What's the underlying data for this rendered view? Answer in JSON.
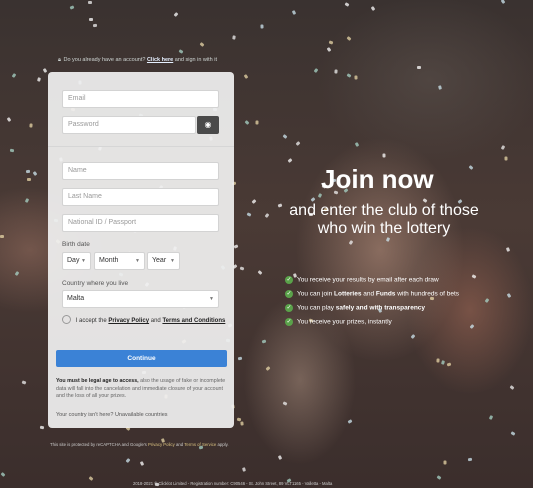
{
  "account_prompt": {
    "text_before": "Do you already have an account?",
    "link": "Click here",
    "text_after": "and sign in with it"
  },
  "form": {
    "email_placeholder": "Email",
    "password_placeholder": "Password",
    "name_placeholder": "Name",
    "last_name_placeholder": "Last Name",
    "national_id_placeholder": "National ID / Passport",
    "birth_date_label": "Birth date",
    "day_value": "Day",
    "month_value": "Month",
    "year_value": "Year",
    "country_label": "Country where you live",
    "country_value": "Malta",
    "accept_prefix": "I accept the",
    "privacy_link": "Privacy Policy",
    "accept_and": "and",
    "terms_link": "Terms and Conditions",
    "continue_label": "Continue",
    "legal_bold": "You must be legal age to access,",
    "legal_text": "also the usage of fake or incomplete data will fall into the cancelation and immediate closure of your account and the loss of all your prizes.",
    "country_missing_text": "Your country isn't here?",
    "country_missing_link": "Unavailable countries"
  },
  "hero": {
    "title": "Join now",
    "subtitle": "and enter the club of those who win the lottery",
    "bullets": [
      {
        "pre": "You receive your results by email after each draw"
      },
      {
        "pre": "You can join ",
        "b1": "Lotteries",
        "mid": " and ",
        "b2": "Funds",
        "post": " with hundreds of bets"
      },
      {
        "pre": "You can play ",
        "b1": "safely and with transparency"
      },
      {
        "pre": "You receive your prizes, instantly"
      }
    ]
  },
  "recaptcha": {
    "text_before": "This site is protected by reCAPTCHA and Google's",
    "privacy": "Privacy Policy",
    "and": "and",
    "terms": "Terms of Service",
    "text_after": "apply."
  },
  "footer": {
    "text": "2018-2021 © Clicklot Limited - Registration number: C90546 - St. John Street, 89 VLT1165 - Valletta - Malta"
  },
  "colors": {
    "accent": "#3b82d6",
    "check_green": "#5aa24a"
  }
}
